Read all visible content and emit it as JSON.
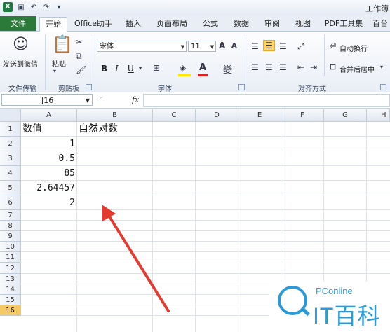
{
  "window": {
    "title": "工作簿"
  },
  "tabs": [
    {
      "label": "文件"
    },
    {
      "label": "开始"
    },
    {
      "label": "Office助手"
    },
    {
      "label": "插入"
    },
    {
      "label": "页面布局"
    },
    {
      "label": "公式"
    },
    {
      "label": "数据"
    },
    {
      "label": "审阅"
    },
    {
      "label": "视图"
    },
    {
      "label": "PDF工具集"
    },
    {
      "label": "百台"
    }
  ],
  "ribbon": {
    "wechat_label": "发送到微信",
    "wechat_group": "文件传输",
    "paste_label": "粘贴",
    "clipboard_group": "剪贴板",
    "font_name": "宋体",
    "font_size": "11",
    "font_group": "字体",
    "bold": "B",
    "italic": "I",
    "underline": "U",
    "grow_font": "A",
    "shrink_font": "A",
    "font_color_glyph": "A",
    "wen": "變",
    "wrap_label": "自动换行",
    "merge_label": "合并后居中",
    "align_group": "对齐方式"
  },
  "formula_bar": {
    "name_box": "J16",
    "fx": "fx",
    "formula": ""
  },
  "columns": [
    "A",
    "B",
    "C",
    "D",
    "E",
    "F",
    "G",
    "H"
  ],
  "rows": [
    "1",
    "2",
    "3",
    "4",
    "5",
    "6",
    "7",
    "8",
    "9",
    "10",
    "11",
    "12",
    "13",
    "14",
    "15",
    "16"
  ],
  "selected_row": "16",
  "cells": {
    "A1": "数值",
    "B1": "自然对数",
    "A2": "1",
    "A3": "0.5",
    "A4": "85",
    "A5": "2.64457",
    "A6": "2"
  },
  "watermark": {
    "top": "PConline",
    "bottom": "IT百科"
  },
  "colors": {
    "file_tab": "#2b7a3a",
    "arrow": "#e53a2f",
    "watermark": "#2a9ad8"
  }
}
